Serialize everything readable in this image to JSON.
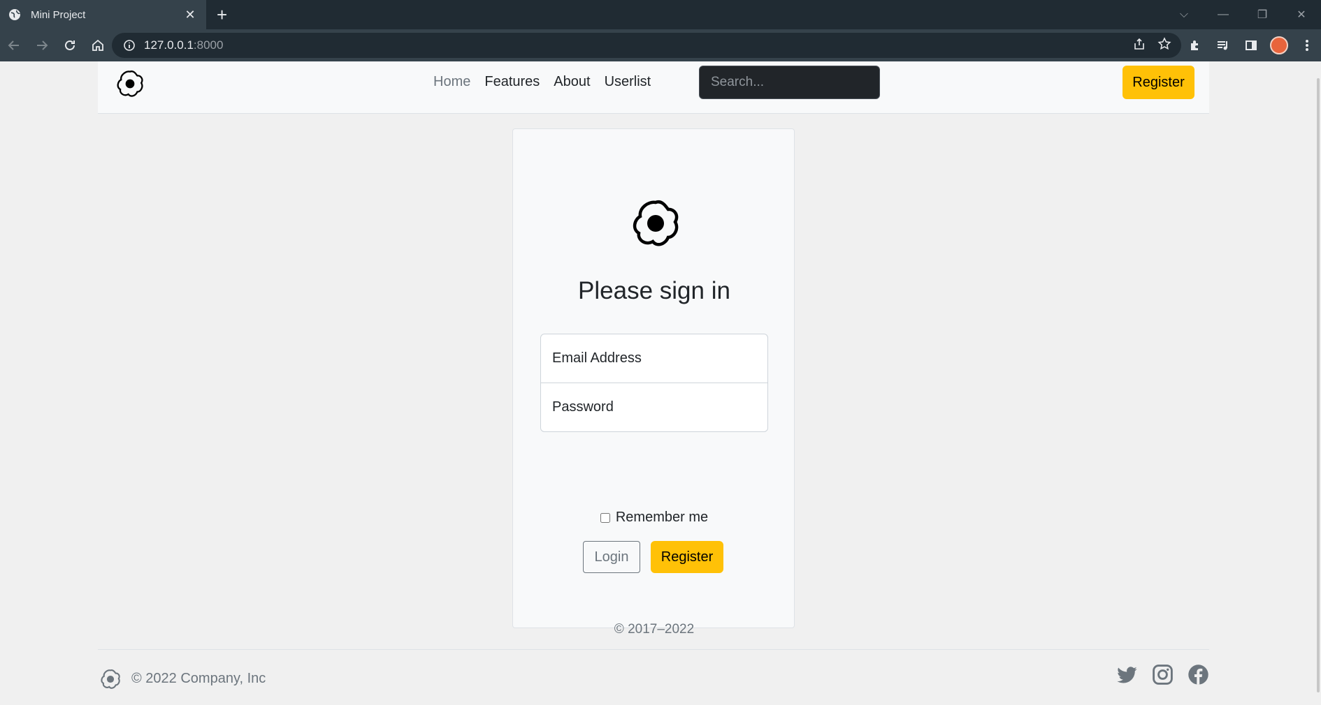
{
  "browser": {
    "tab_title": "Mini Project",
    "url_host": "127.0.0.1",
    "url_port": ":8000"
  },
  "navbar": {
    "links": [
      "Home",
      "Features",
      "About",
      "Userlist"
    ],
    "search_placeholder": "Search...",
    "register_label": "Register"
  },
  "signin": {
    "title": "Please sign in",
    "email_placeholder": "Email Address",
    "password_placeholder": "Password",
    "remember_label": "Remember me",
    "login_label": "Login",
    "register_label": "Register",
    "copyright": "© 2017–2022"
  },
  "footer": {
    "text": "© 2022 Company, Inc",
    "social_icons": [
      "twitter-icon",
      "instagram-icon",
      "facebook-icon"
    ]
  },
  "colors": {
    "accent": "#ffc107",
    "chrome_dark": "#202b33",
    "chrome_tab": "#35424b",
    "page_bg": "#f8f9fa"
  }
}
